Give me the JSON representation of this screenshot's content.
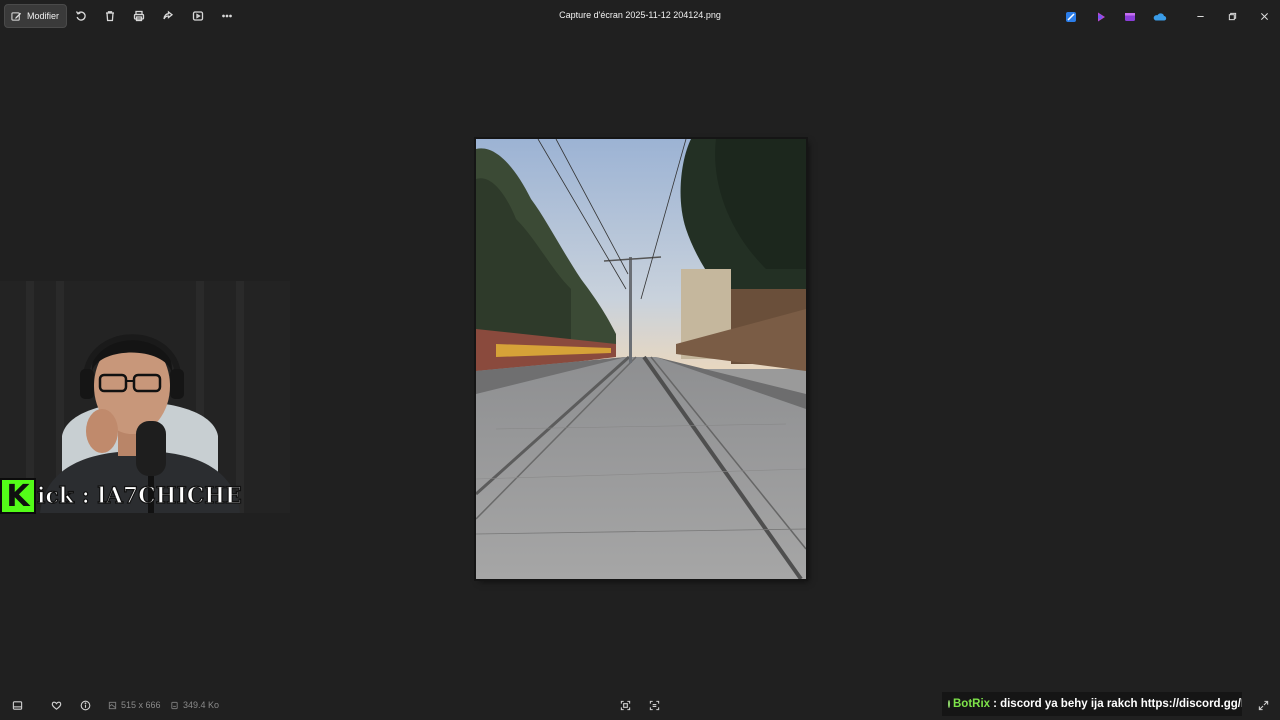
{
  "toolbar": {
    "edit_label": "Modifier",
    "tools": [
      "rotate-icon",
      "delete-icon",
      "print-icon",
      "share-icon",
      "slideshow-icon",
      "more-icon"
    ]
  },
  "window": {
    "title": "Capture d'écran 2025-11-12 204124.png",
    "app_icons": [
      "designer-icon",
      "clipchamp-icon",
      "video-editor-icon",
      "onedrive-icon"
    ]
  },
  "photo": {
    "scene": "railway-tracks"
  },
  "overlay": {
    "kick_letter": "K",
    "kick_handle": "ick : lA7CHICHE",
    "chat_user": "BotRix",
    "chat_message": ": discord ya behy ija rakch https://discord.gg/EWQvEQaxAk"
  },
  "status": {
    "dimensions": "515 x 666",
    "file_size": "349.4 Ko"
  },
  "colors": {
    "background": "#202020",
    "kick_green": "#53fc18",
    "botrix_green": "#7ee34a"
  }
}
